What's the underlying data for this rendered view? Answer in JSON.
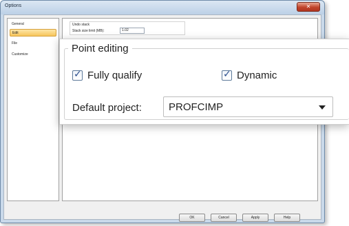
{
  "window": {
    "title": "Options",
    "close_glyph": "✕"
  },
  "sidebar": {
    "items": [
      {
        "label": "General",
        "selected": false
      },
      {
        "label": "Edit",
        "selected": true
      },
      {
        "label": "File",
        "selected": false
      },
      {
        "label": "Customize",
        "selected": false
      }
    ]
  },
  "undo_stack": {
    "title": "Undo stack",
    "size_label": "Stack size limit (MB):",
    "size_value": "1.02"
  },
  "point_editing": {
    "title": "Point editing",
    "fully_qualify_label": "Fully qualify",
    "fully_qualify_checked": true,
    "dynamic_label": "Dynamic",
    "dynamic_checked": true,
    "default_project_label": "Default project:",
    "default_project_value": "PROFCIMP"
  },
  "buttons": {
    "ok": "OK",
    "cancel": "Cancel",
    "apply": "Apply",
    "help": "Help"
  },
  "icons": {
    "checkmark": "✓",
    "dropdown": "chevron-down-icon",
    "close": "close-icon"
  },
  "colors": {
    "selection": "#f7c55b",
    "title_bar": "#c9d9ea",
    "close_button": "#c0432a"
  }
}
